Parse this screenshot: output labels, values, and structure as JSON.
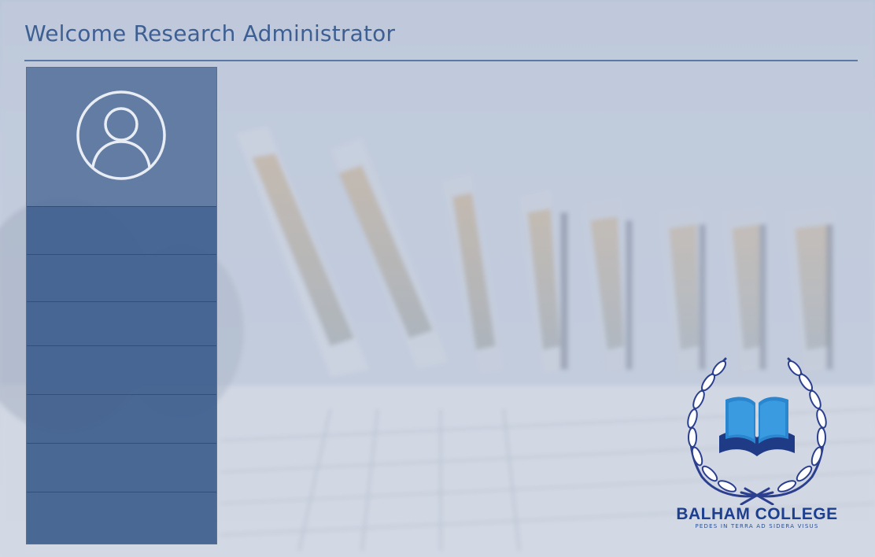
{
  "header": {
    "title": "Welcome Research Administrator"
  },
  "sidebar": {
    "avatar_icon": "user-circle-icon",
    "items": [
      {
        "label": ""
      },
      {
        "label": ""
      },
      {
        "label": ""
      },
      {
        "label": ""
      },
      {
        "label": ""
      },
      {
        "label": ""
      },
      {
        "label": ""
      }
    ]
  },
  "branding": {
    "college_name": "BALHAM COLLEGE",
    "motto": "PEDES IN TERRA AD SIDERA VISUS",
    "logo_icon": "open-book-laurel-icon"
  },
  "colors": {
    "accent": "#3d5f92",
    "sidebar": "#4a6896",
    "brand": "#1d3f8f"
  }
}
